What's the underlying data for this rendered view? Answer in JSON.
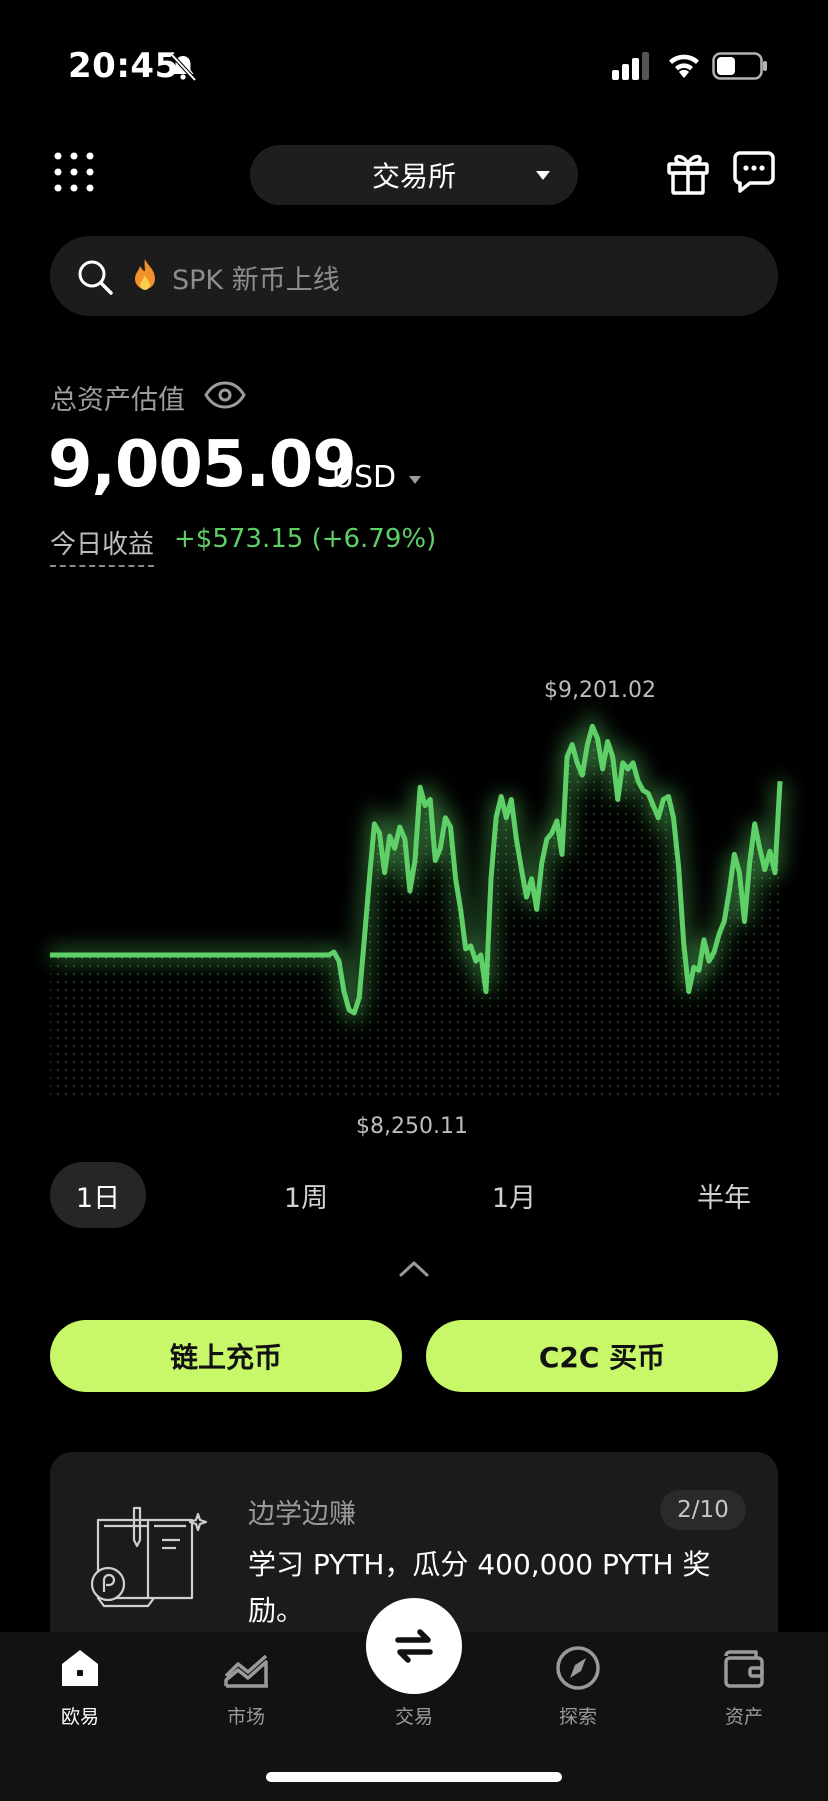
{
  "status_bar": {
    "time": "20:45"
  },
  "header": {
    "selector_label": "交易所"
  },
  "search": {
    "placeholder": "SPK 新币上线"
  },
  "assets": {
    "title": "总资产估值",
    "balance": "9,005.09",
    "currency": "USD",
    "today_pnl_label": "今日收益",
    "today_pnl_value": "+$573.15 (+6.79%)"
  },
  "chart_data": {
    "type": "area",
    "title": "",
    "xlabel": "",
    "ylabel": "",
    "high_label": "$9,201.02",
    "low_label": "$8,250.11",
    "ylim": [
      8250.11,
      9201.02
    ],
    "color": "#5fd068",
    "y": [
      8450,
      8450,
      8450,
      8450,
      8450,
      8450,
      8450,
      8450,
      8450,
      8450,
      8450,
      8450,
      8450,
      8450,
      8450,
      8450,
      8450,
      8450,
      8450,
      8450,
      8450,
      8450,
      8450,
      8450,
      8450,
      8450,
      8450,
      8450,
      8450,
      8450,
      8450,
      8450,
      8450,
      8450,
      8450,
      8450,
      8450,
      8450,
      8450,
      8450,
      8450,
      8450,
      8450,
      8450,
      8450,
      8450,
      8450,
      8450,
      8450,
      8450,
      8450,
      8450,
      8450,
      8450,
      8450,
      8450,
      8460,
      8430,
      8330,
      8270,
      8260,
      8310,
      8500,
      8700,
      8880,
      8850,
      8720,
      8840,
      8800,
      8870,
      8830,
      8660,
      8760,
      9000,
      8940,
      8960,
      8760,
      8800,
      8900,
      8870,
      8700,
      8600,
      8470,
      8480,
      8430,
      8450,
      8330,
      8700,
      8900,
      8970,
      8900,
      8960,
      8830,
      8730,
      8640,
      8700,
      8600,
      8750,
      8830,
      8850,
      8890,
      8780,
      9100,
      9140,
      9080,
      9040,
      9140,
      9200,
      9160,
      9060,
      9150,
      9100,
      8960,
      9080,
      9060,
      9080,
      9020,
      8990,
      8980,
      8940,
      8900,
      8960,
      8970,
      8900,
      8740,
      8490,
      8330,
      8410,
      8400,
      8500,
      8430,
      8460,
      8520,
      8560,
      8660,
      8780,
      8720,
      8560,
      8750,
      8880,
      8800,
      8730,
      8790,
      8720,
      9020
    ]
  },
  "ranges": [
    "1日",
    "1周",
    "1月",
    "半年"
  ],
  "actions": {
    "deposit_label": "链上充币",
    "c2c_label": "C2C 买币"
  },
  "card": {
    "title": "边学边赚",
    "badge": "2/10",
    "body": "学习 PYTH，瓜分 400,000 PYTH 奖励。"
  },
  "tabs": [
    "欧易",
    "市场",
    "交易",
    "探索",
    "资产"
  ],
  "colors": {
    "accent": "#c8f76a",
    "positive": "#5fd068",
    "background": "#000000"
  }
}
